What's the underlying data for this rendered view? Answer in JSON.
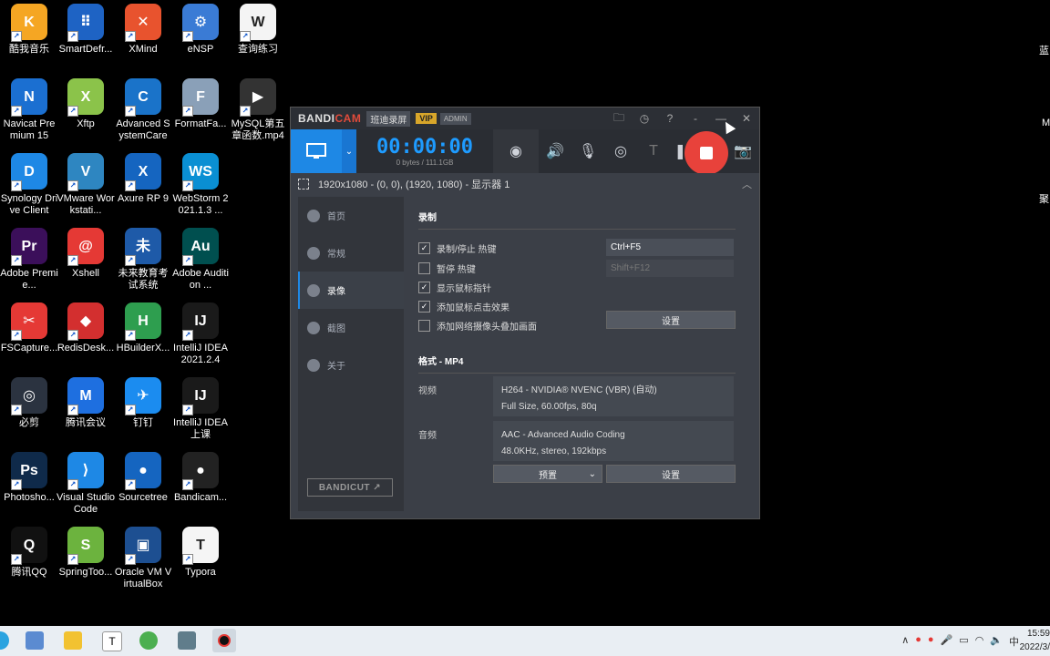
{
  "desktop": {
    "icons": [
      {
        "label": "酷我音乐",
        "color": "#f5a623",
        "glyph": "K"
      },
      {
        "label": "SmartDefr...",
        "color": "#1e63c4",
        "glyph": "⠿"
      },
      {
        "label": "XMind",
        "color": "#e8532e",
        "glyph": "✕"
      },
      {
        "label": "eNSP",
        "color": "#3a7bd5",
        "glyph": "⚙"
      },
      {
        "label": "查询练习",
        "color": "#f4f4f4",
        "glyph": "W"
      },
      {
        "label": "Navicat Premium 15",
        "color": "#1b6fd1",
        "glyph": "N"
      },
      {
        "label": "Xftp",
        "color": "#8bc34a",
        "glyph": "X"
      },
      {
        "label": "Advanced SystemCare",
        "color": "#1a73c9",
        "glyph": "C"
      },
      {
        "label": "FormatFa...",
        "color": "#8aa0b8",
        "glyph": "F"
      },
      {
        "label": "MySQL第五章函数.mp4",
        "color": "#333333",
        "glyph": "▶"
      },
      {
        "label": "Synology Drive Client",
        "color": "#1e88e5",
        "glyph": "D"
      },
      {
        "label": "VMware Workstati...",
        "color": "#2e86c1",
        "glyph": "V"
      },
      {
        "label": "Axure RP 9",
        "color": "#1565c0",
        "glyph": "X"
      },
      {
        "label": "WebStorm 2021.1.3 ...",
        "color": "#0a8fd3",
        "glyph": "WS"
      },
      {
        "label": "Adobe Premie...",
        "color": "#3b0f5a",
        "glyph": "Pr"
      },
      {
        "label": "Xshell",
        "color": "#e53935",
        "glyph": "@"
      },
      {
        "label": "未来教育考试系统",
        "color": "#1e5aa8",
        "glyph": "未"
      },
      {
        "label": "Adobe Audition ...",
        "color": "#004f4f",
        "glyph": "Au"
      },
      {
        "label": "FSCapture...",
        "color": "#e53935",
        "glyph": "✂"
      },
      {
        "label": "RedisDesk...",
        "color": "#d32f2f",
        "glyph": "◆"
      },
      {
        "label": "HBuilderX...",
        "color": "#2e9e4f",
        "glyph": "H"
      },
      {
        "label": "IntelliJ IDEA 2021.2.4",
        "color": "#1a1a1a",
        "glyph": "IJ"
      },
      {
        "label": "必剪",
        "color": "#2b3340",
        "glyph": "◎"
      },
      {
        "label": "腾讯会议",
        "color": "#1e6fe0",
        "glyph": "M"
      },
      {
        "label": "钉钉",
        "color": "#1b8cf0",
        "glyph": "✈"
      },
      {
        "label": "IntelliJ IDEA 上课",
        "color": "#1a1a1a",
        "glyph": "IJ"
      },
      {
        "label": "Photosho...",
        "color": "#0f2a4a",
        "glyph": "Ps"
      },
      {
        "label": "Visual Studio Code",
        "color": "#1e88e5",
        "glyph": "⟩"
      },
      {
        "label": "Sourcetree",
        "color": "#1565c0",
        "glyph": "●"
      },
      {
        "label": "Bandicam...",
        "color": "#222222",
        "glyph": "●"
      },
      {
        "label": "腾讯QQ",
        "color": "#111111",
        "glyph": "Q"
      },
      {
        "label": "SpringToo...",
        "color": "#6cb33e",
        "glyph": "S"
      },
      {
        "label": "Oracle VM VirtualBox",
        "color": "#1d4f91",
        "glyph": "▣"
      },
      {
        "label": "Typora",
        "color": "#f5f5f5",
        "glyph": "T"
      }
    ],
    "edge_texts": [
      "蓝",
      "M",
      "聚"
    ]
  },
  "bandicam": {
    "logo_main": "BANDI",
    "logo_accent": "CAM",
    "brand_cn": "班迪录屏",
    "vip": "VIP",
    "admin": "ADMIN",
    "title_buttons": {
      "folder": "🗀",
      "history": "◷",
      "help": "?",
      "dash": "-",
      "minimize": "—",
      "close": "✕"
    },
    "timer": "00:00:00",
    "bytes": "0 bytes / 111.1GB",
    "region": "1920x1080 - (0, 0), (1920, 1080) - 显示器 1",
    "sidebar": [
      {
        "label": "首页",
        "active": false
      },
      {
        "label": "常规",
        "active": false
      },
      {
        "label": "录像",
        "active": true
      },
      {
        "label": "截图",
        "active": false
      },
      {
        "label": "关于",
        "active": false
      }
    ],
    "bandicut": "BANDICUT ↗",
    "record_section": "录制",
    "options": [
      {
        "label": "录制/停止 热键",
        "checked": true
      },
      {
        "label": "暂停 热键",
        "checked": false
      },
      {
        "label": "显示鼠标指针",
        "checked": true
      },
      {
        "label": "添加鼠标点击效果",
        "checked": true
      },
      {
        "label": "添加网络摄像头叠加画面",
        "checked": false
      }
    ],
    "hotkey_record": "Ctrl+F5",
    "hotkey_pause": "Shift+F12",
    "settings_btn": "设置",
    "format_section": "格式 - MP4",
    "video_label": "视频",
    "video_line1": "H264 - NVIDIA® NVENC (VBR) (自动)",
    "video_line2": "Full Size, 60.00fps, 80q",
    "audio_label": "音频",
    "audio_line1": "AAC - Advanced Audio Coding",
    "audio_line2": "48.0KHz, stereo, 192kbps",
    "preset_btn": "预置",
    "settings_btn2": "设置"
  },
  "taskbar": {
    "clock_time": "15:59",
    "clock_date": "2022/3/",
    "tray_icons": [
      "∧",
      "●",
      "●",
      "🎤",
      "▭",
      "◠",
      "🔈",
      "中"
    ]
  }
}
